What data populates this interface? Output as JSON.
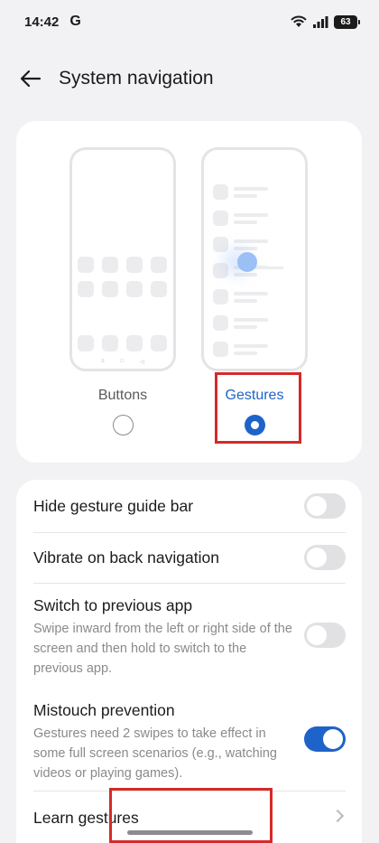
{
  "status_bar": {
    "time": "14:42",
    "carrier_icon": "google-g-icon",
    "battery": "63"
  },
  "header": {
    "back_icon": "arrow-left-icon",
    "title": "System navigation"
  },
  "navigation_options": [
    {
      "label": "Buttons",
      "selected": false
    },
    {
      "label": "Gestures",
      "selected": true
    }
  ],
  "settings": {
    "hide_guide_bar": {
      "title": "Hide gesture guide bar",
      "enabled": false
    },
    "vibrate_back": {
      "title": "Vibrate on back navigation",
      "enabled": false
    },
    "switch_prev": {
      "title": "Switch to previous app",
      "desc": "Swipe inward from the left or right side of the screen and then hold to switch to the previous app.",
      "enabled": false
    },
    "mistouch": {
      "title": "Mistouch prevention",
      "desc": "Gestures need 2 swipes to take effect in some full screen scenarios (e.g., watching videos or playing games).",
      "enabled": true
    },
    "learn": {
      "title": "Learn gestures"
    }
  },
  "colors": {
    "accent": "#1e63c9",
    "highlight": "#d42a2a",
    "background": "#f2f2f4"
  }
}
